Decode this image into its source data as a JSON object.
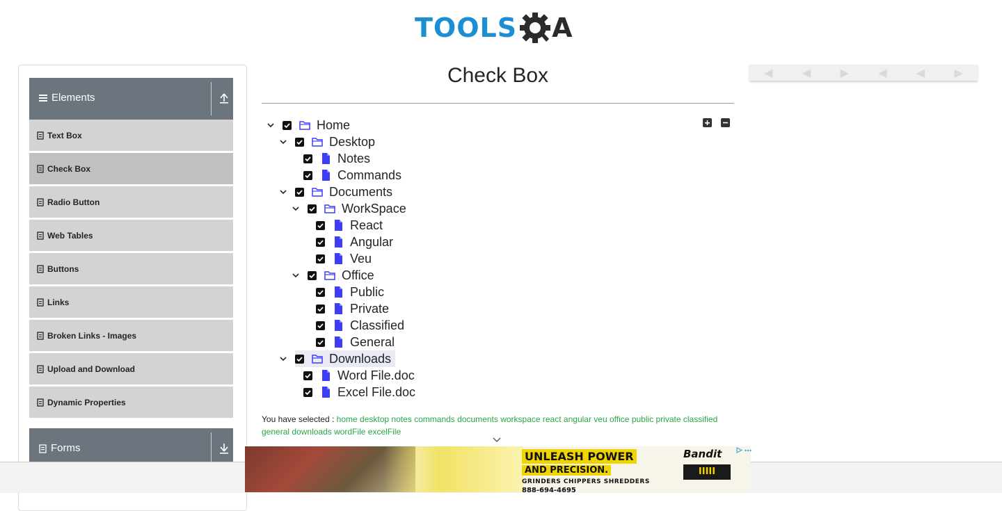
{
  "logo": {
    "text": "TOOLS",
    "text_suffix": "A",
    "accent": "#1b8fd2"
  },
  "sidebar": {
    "group_elements": {
      "label": "Elements",
      "icon": "hamburger-icon"
    },
    "items": [
      {
        "label": "Text Box"
      },
      {
        "label": "Check Box",
        "active": true
      },
      {
        "label": "Radio Button"
      },
      {
        "label": "Web Tables"
      },
      {
        "label": "Buttons"
      },
      {
        "label": "Links"
      },
      {
        "label": "Broken Links - Images"
      },
      {
        "label": "Upload and Download"
      },
      {
        "label": "Dynamic Properties"
      }
    ],
    "group_forms": {
      "label": "Forms",
      "icon": "form-icon"
    }
  },
  "main": {
    "title": "Check Box",
    "tree": {
      "home": "Home",
      "desktop": "Desktop",
      "notes": "Notes",
      "commands": "Commands",
      "documents": "Documents",
      "workspace": "WorkSpace",
      "react": "React",
      "angular": "Angular",
      "veu": "Veu",
      "office": "Office",
      "public": "Public",
      "private": "Private",
      "classified": "Classified",
      "general": "General",
      "downloads": "Downloads",
      "wordfile": "Word File.doc",
      "excelfile": "Excel File.doc"
    },
    "result_label": "You have selected :",
    "selected": [
      "home",
      "desktop",
      "notes",
      "commands",
      "documents",
      "workspace",
      "react",
      "angular",
      "veu",
      "office",
      "public",
      "private",
      "classified",
      "general",
      "downloads",
      "wordFile",
      "excelFile"
    ],
    "colors": {
      "selected_text": "#28a745",
      "folder_icon": "#3d3df5",
      "file_icon": "#3d3df5"
    }
  },
  "ad": {
    "line1": "UNLEASH POWER",
    "line2": "AND PRECISION.",
    "line3": "GRINDERS  CHIPPERS  SHREDDERS",
    "line4": "888-694-4695",
    "brand": "Bandit",
    "badge": "IIIII"
  }
}
